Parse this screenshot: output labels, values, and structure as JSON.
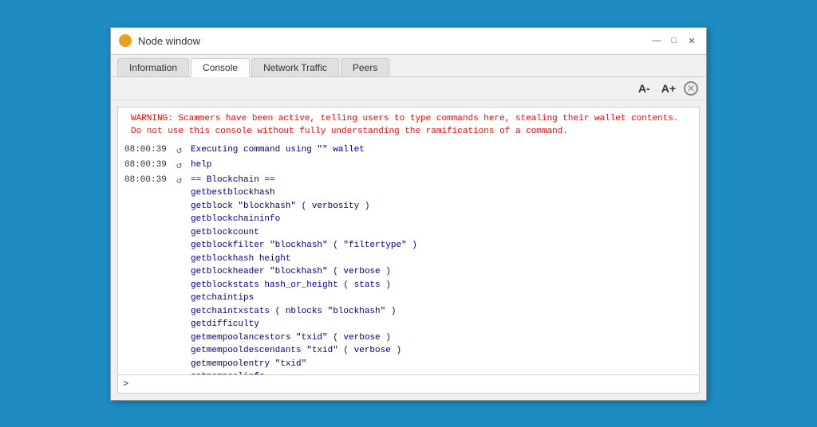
{
  "window": {
    "title": "Node window",
    "icon": "node-icon"
  },
  "title_controls": {
    "minimize": "—",
    "maximize": "□",
    "close": "✕"
  },
  "tabs": [
    {
      "label": "Information",
      "active": false
    },
    {
      "label": "Console",
      "active": true
    },
    {
      "label": "Network Traffic",
      "active": false
    },
    {
      "label": "Peers",
      "active": false
    }
  ],
  "toolbar": {
    "font_decrease": "A-",
    "font_increase": "A+",
    "close_label": "✕"
  },
  "console": {
    "warning": "WARNING: Scammers have been active, telling users to type commands here, stealing their wallet contents. Do not use this console without fully understanding the ramifications of a command.",
    "log_entries": [
      {
        "time": "08:00:39",
        "icon": "↺",
        "content": "Executing command using \"\" wallet",
        "color": "blue"
      },
      {
        "time": "08:00:39",
        "icon": "↺",
        "content": "help",
        "color": "blue"
      },
      {
        "time": "08:00:39",
        "icon": "↺",
        "content_lines": [
          "== Blockchain ==",
          "getbestblockhash",
          "getblock \"blockhash\" ( verbosity )",
          "getblockchaininfo",
          "getblockcount",
          "getblockfilter \"blockhash\" ( \"filtertype\" )",
          "getblockhash height",
          "getblockheader \"blockhash\" ( verbose )",
          "getblockstats hash_or_height ( stats )",
          "getchaintips",
          "getchaintxstats ( nblocks \"blockhash\" )",
          "getdifficulty",
          "getmempoolancestors \"txid\" ( verbose )",
          "getmempooldescendants \"txid\" ( verbose )",
          "getmempoolentry \"txid\"",
          "getmempoolinfo"
        ],
        "color": "blue"
      }
    ],
    "input_placeholder": "",
    "prompt": ">"
  }
}
